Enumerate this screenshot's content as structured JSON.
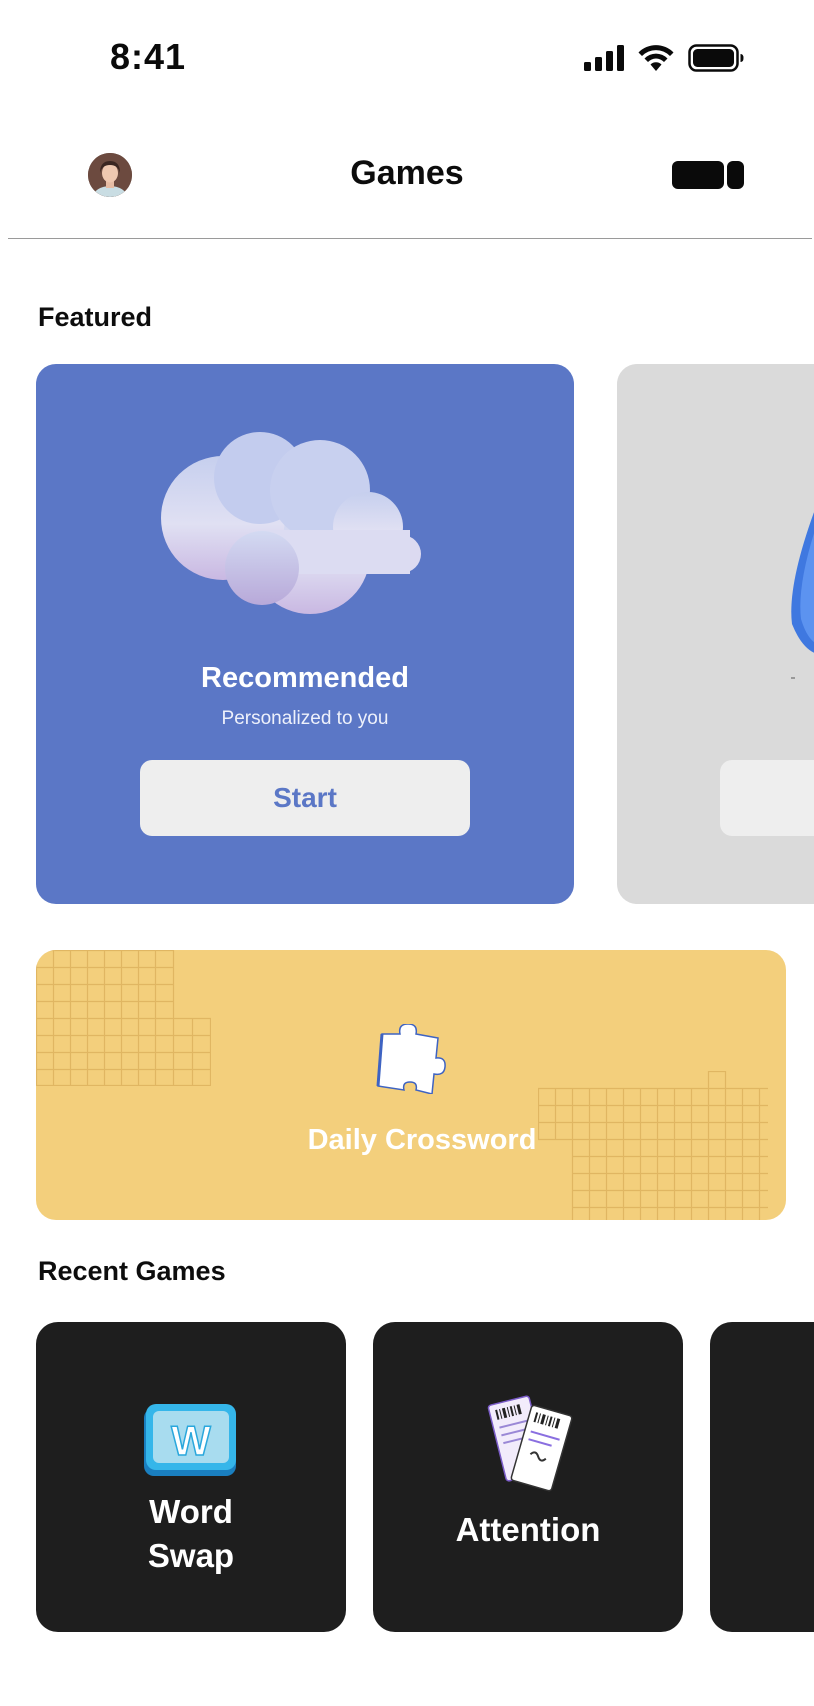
{
  "status_bar": {
    "time": "8:41"
  },
  "header": {
    "title": "Games"
  },
  "featured": {
    "heading": "Featured",
    "cards": [
      {
        "title": "Recommended",
        "subtitle": "Personalized to you",
        "button_label": "Start"
      }
    ]
  },
  "daily": {
    "title": "Daily Crossword"
  },
  "recent": {
    "heading": "Recent Games",
    "games": [
      {
        "line1": "Word",
        "line2": "Swap",
        "tile_letter": "W"
      },
      {
        "label": "Attention"
      }
    ]
  },
  "colors": {
    "recommended_card": "#5b77c6",
    "crossword_card": "#f3cf7c",
    "game_card": "#1e1e1e",
    "secondary_card": "#dadada"
  },
  "icons": [
    "cellular-signal-icon",
    "wifi-icon",
    "battery-icon",
    "toggle-view-icon",
    "cloud-illustration",
    "puzzle-piece-icon",
    "word-tile-icon",
    "tickets-icon"
  ]
}
